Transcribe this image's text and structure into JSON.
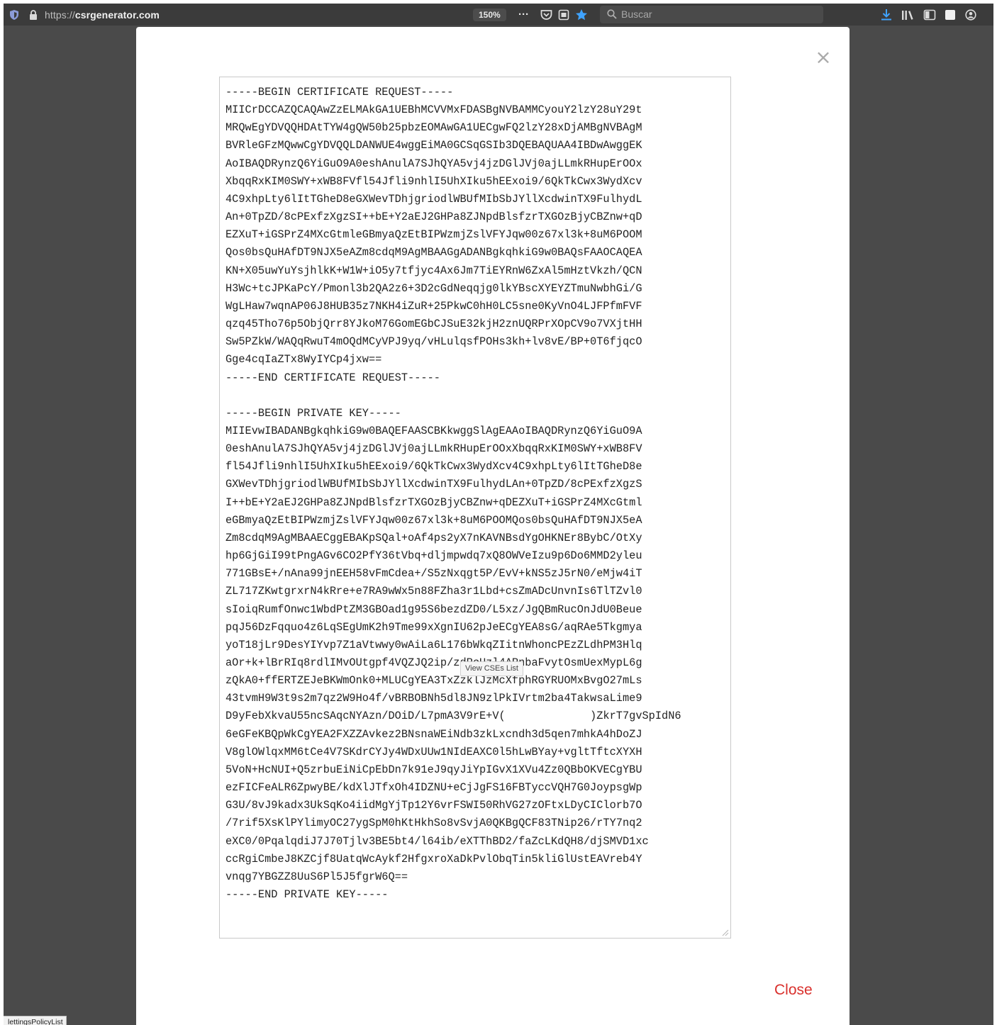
{
  "browser": {
    "url_prefix": "https://",
    "url_domain": "csrgenerator.com",
    "zoom": "150%",
    "overflow_menu": "···",
    "search_placeholder": "Buscar"
  },
  "status_bar": "lettingsPolicyList",
  "modal": {
    "close_x": "×",
    "close_label": "Close",
    "tooltip": "View CSEs List",
    "csr_lines": [
      "-----BEGIN CERTIFICATE REQUEST-----",
      "MIICrDCCAZQCAQAwZzELMAkGA1UEBhMCVVMxFDASBgNVBAMMCyouY2lzY28uY29t",
      "MRQwEgYDVQQHDAtTYW4gQW50b25pbzEOMAwGA1UECgwFQ2lzY28xDjAMBgNVBAgM",
      "BVRleGFzMQwwCgYDVQQLDANWUE4wggEiMA0GCSqGSIb3DQEBAQUAA4IBDwAwggEK",
      "AoIBAQDRynzQ6YiGuO9A0eshAnulA7SJhQYA5vj4jzDGlJVj0ajLLmkRHupErOOx",
      "XbqqRxKIM0SWY+xWB8FVfl54Jfli9nhlI5UhXIku5hEExoi9/6QkTkCwx3WydXcv",
      "4C9xhpLty6lItTGheD8eGXWevTDhjgriodlWBUfMIbSbJYllXcdwinTX9FulhydL",
      "An+0TpZD/8cPExfzXgzSI++bE+Y2aEJ2GHPa8ZJNpdBlsfzrTXGOzBjyCBZnw+qD",
      "EZXuT+iGSPrZ4MXcGtmleGBmyaQzEtBIPWzmjZslVFYJqw00z67xl3k+8uM6POOM",
      "Qos0bsQuHAfDT9NJX5eAZm8cdqM9AgMBAAGgADANBgkqhkiG9w0BAQsFAAOCAQEA",
      "KN+X05uwYuYsjhlkK+W1W+iO5y7tfjyc4Ax6Jm7TiEYRnW6ZxAl5mHztVkzh/QCN",
      "H3Wc+tcJPKaPcY/Pmonl3b2QA2z6+3D2cGdNeqqjg0lkYBscXYEYZTmuNwbhGi/G",
      "WgLHaw7wqnAP06J8HUB35z7NKH4iZuR+25PkwC0hH0LC5sne0KyVnO4LJFPfmFVF",
      "qzq45Tho76p5ObjQrr8YJkoM76GomEGbCJSuE32kjH2znUQRPrXOpCV9o7VXjtHH",
      "Sw5PZkW/WAQqRwuT4mOQdMCyVPJ9yq/vHLulqsfPOHs3kh+lv8vE/BP+0T6fjqcO",
      "Gge4cqIaZTx8WyIYCp4jxw==",
      "-----END CERTIFICATE REQUEST-----",
      "",
      "-----BEGIN PRIVATE KEY-----",
      "MIIEvwIBADANBgkqhkiG9w0BAQEFAASCBKkwggSlAgEAAoIBAQDRynzQ6YiGuO9A",
      "0eshAnulA7SJhQYA5vj4jzDGlJVj0ajLLmkRHupErOOxXbqqRxKIM0SWY+xWB8FV",
      "fl54Jfli9nhlI5UhXIku5hEExoi9/6QkTkCwx3WydXcv4C9xhpLty6lItTGheD8e",
      "GXWevTDhjgriodlWBUfMIbSbJYllXcdwinTX9FulhydLAn+0TpZD/8cPExfzXgzS",
      "I++bE+Y2aEJ2GHPa8ZJNpdBlsfzrTXGOzBjyCBZnw+qDEZXuT+iGSPrZ4MXcGtml",
      "eGBmyaQzEtBIPWzmjZslVFYJqw00z67xl3k+8uM6POOMQos0bsQuHAfDT9NJX5eA",
      "Zm8cdqM9AgMBAAECggEBAKpSQal+oAf4ps2yX7nKAVNBsdYgOHKNEr8BybC/OtXy",
      "hp6GjGiI99tPngAGv6CO2PfY36tVbq+dljmpwdq7xQ8OWVeIzu9p6Do6MMD2yleu",
      "771GBsE+/nAna99jnEEH58vFmCdea+/S5zNxqgt5P/EvV+kNS5zJ5rN0/eMjw4iT",
      "ZL717ZKwtgrxrN4kRre+e7RA9wWx5n88FZha3r1Lbd+csZmADcUnvnIs6TlTZvl0",
      "sIoiqRumfOnwc1WbdPtZM3GBOad1g95S6bezdZD0/L5xz/JgQBmRucOnJdU0Beue",
      "pqJ56DzFqquo4z6LqSEgUmK2h9Tme99xXgnIU62pJeECgYEA8sG/aqRAe5Tkgmya",
      "yoT18jLr9DesYIYvp7Z1aVtwwy0wAiLa6L176bWkqZIitnWhoncPEzZLdhPM3Hlq",
      "aOr+k+lBrRIq8rdlIMvOUtgpf4VQZJQ2ip/zdRcUzl4ARnbaFvytOsmUexMypL6g",
      "zQkA0+ffERTZEJeBKWmOnk0+MLUCgYEA3TxZzklJzMcXfphRGYRUOMxBvgO27mLs",
      "43tvmH9W3t9s2m7qz2W9Ho4f/vBRBOBNh5dl8JN9zlPkIVrtm2ba4TakwsaLime9",
      "D9yFebXkvaU55ncSAqcNYAzn/DOiD/L7pmA3V9rE+V(             )ZkrT7gvSpIdN6",
      "6eGFeKBQpWkCgYEA2FXZZAvkez2BNsnaWEiNdb3zkLxcndh3d5qen7mhkA4hDoZJ",
      "V8glOWlqxMM6tCe4V7SKdrCYJy4WDxUUw1NIdEAXC0l5hLwBYay+vgltTftcXYXH",
      "5VoN+HcNUI+Q5zrbuEiNiCpEbDn7k91eJ9qyJiYpIGvX1XVu4Zz0QBbOKVECgYBU",
      "ezFICFeALR6ZpwyBE/kdXlJTfxOh4IDZNU+eCjJgFS16FBTyccVQH7G0JoypsgWp",
      "G3U/8vJ9kadx3UkSqKo4iidMgYjTp12Y6vrFSWI50RhVG27zOFtxLDyCIClorb7O",
      "/7rif5XsKlPYlimyOC27ygSpM0hKtHkhSo8vSvjA0QKBgQCF83TNip26/rTY7nq2",
      "eXC0/0PqalqdiJ7J70Tjlv3BE5bt4/l64ib/eXTThBD2/faZcLKdQH8/djSMVD1xc",
      "ccRgiCmbeJ8KZCjf8UatqWcAykf2HfgxroXaDkPvlObqTin5kliGlUstEAVreb4Y",
      "vnqg7YBGZZ8UuS6Pl5J5fgrW6Q==",
      "-----END PRIVATE KEY-----"
    ]
  }
}
